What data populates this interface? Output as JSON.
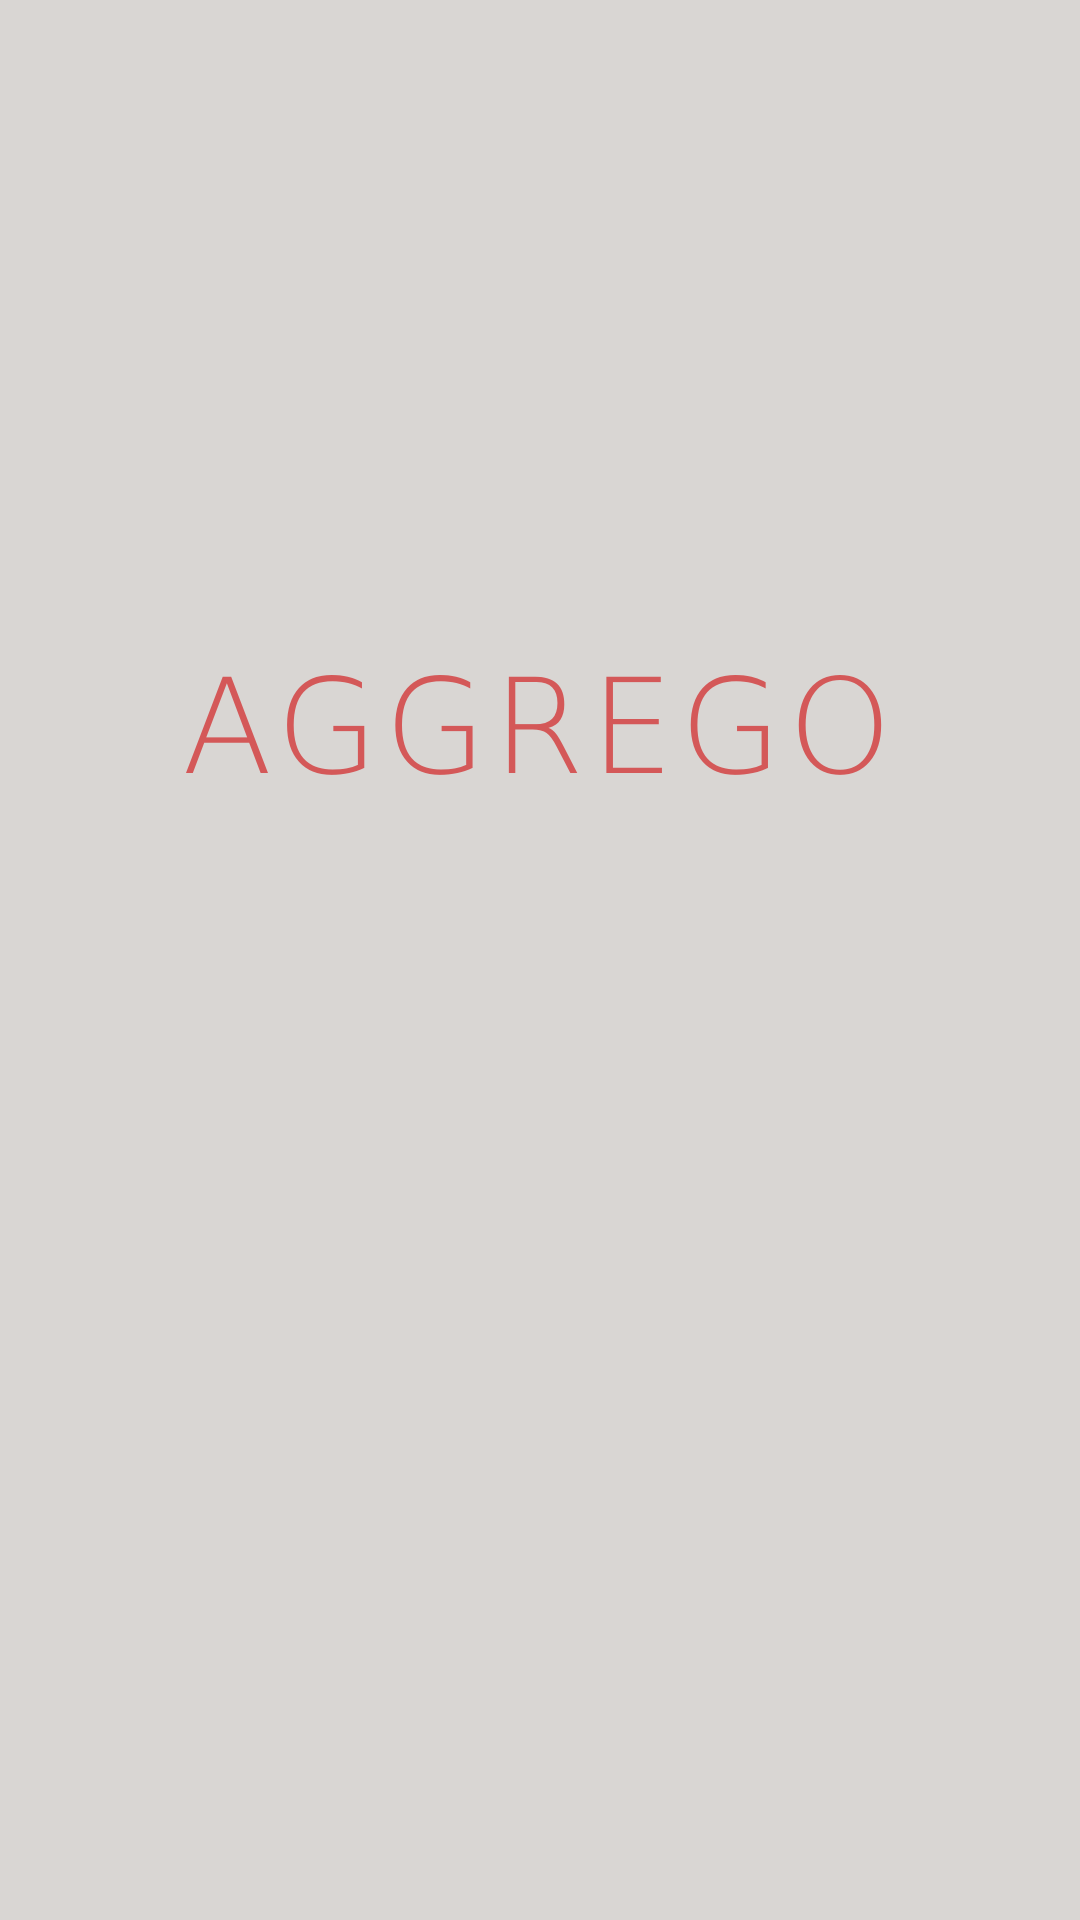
{
  "splash": {
    "logo_text": "AGGREGO",
    "background_color": "#d9d6d3",
    "logo_color": "#d45858"
  }
}
